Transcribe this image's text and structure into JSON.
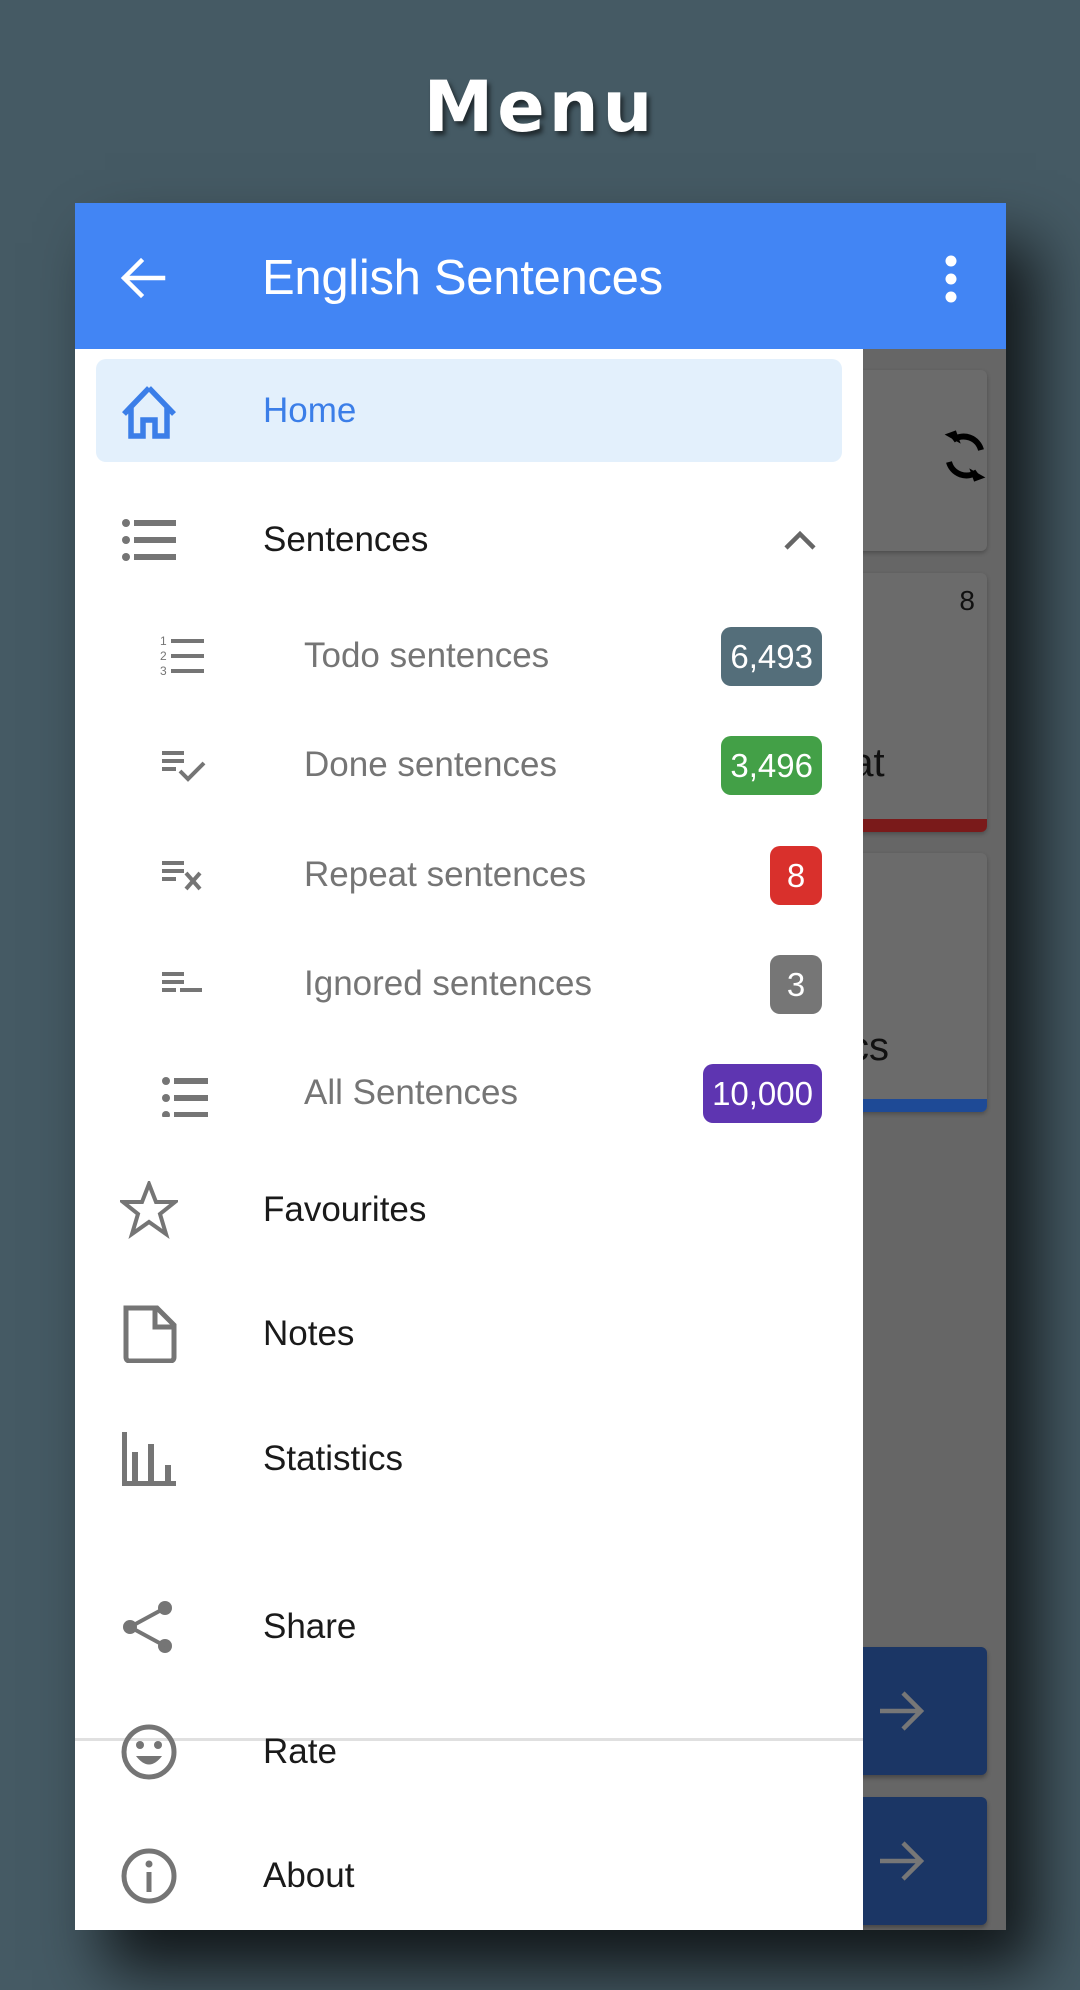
{
  "heading": "Menu",
  "app_bar": {
    "title": "English Sentences",
    "back_icon": "arrow-left-icon",
    "more_icon": "more-vert-icon"
  },
  "drawer": {
    "items": [
      {
        "label": "Home",
        "icon": "home-icon",
        "active": true
      },
      {
        "label": "Sentences",
        "icon": "list-bulleted-icon",
        "expanded": true,
        "chevron": "chevron-up-icon"
      },
      {
        "label": "Favourites",
        "icon": "star-outline-icon"
      },
      {
        "label": "Notes",
        "icon": "note-icon"
      },
      {
        "label": "Statistics",
        "icon": "bar-chart-icon"
      }
    ],
    "sub_items": [
      {
        "label": "Todo sentences",
        "icon": "list-numbered-icon",
        "count": "6,493",
        "color": "#546e7a"
      },
      {
        "label": "Done sentences",
        "icon": "playlist-check-icon",
        "count": "3,496",
        "color": "#43a047"
      },
      {
        "label": "Repeat sentences",
        "icon": "playlist-remove-icon",
        "count": "8",
        "color": "#d9302c"
      },
      {
        "label": "Ignored sentences",
        "icon": "playlist-minus-icon",
        "count": "3",
        "color": "#767676"
      },
      {
        "label": "All Sentences",
        "icon": "list-bulleted-icon",
        "count": "10,000",
        "color": "#5e35b1"
      }
    ],
    "footer_items": [
      {
        "label": "Share",
        "icon": "share-icon"
      },
      {
        "label": "Rate",
        "icon": "smiley-icon"
      },
      {
        "label": "About",
        "icon": "info-icon"
      }
    ]
  },
  "background_screen": {
    "sync_icon": "sync-icon",
    "repeat_card": {
      "count": "8",
      "label_fragment": "eat",
      "accent": "#7a1a1a"
    },
    "statistics_card": {
      "label_fragment": "tics",
      "accent": "#1e4a96"
    },
    "arrow_buttons": [
      "arrow-right-icon",
      "arrow-right-icon"
    ]
  },
  "colors": {
    "background": "#455a64",
    "app_bar": "#4285f4",
    "active_item_bg": "#e3f0fc",
    "active_item_text": "#3b7ee8",
    "icon_grey": "#757575"
  }
}
